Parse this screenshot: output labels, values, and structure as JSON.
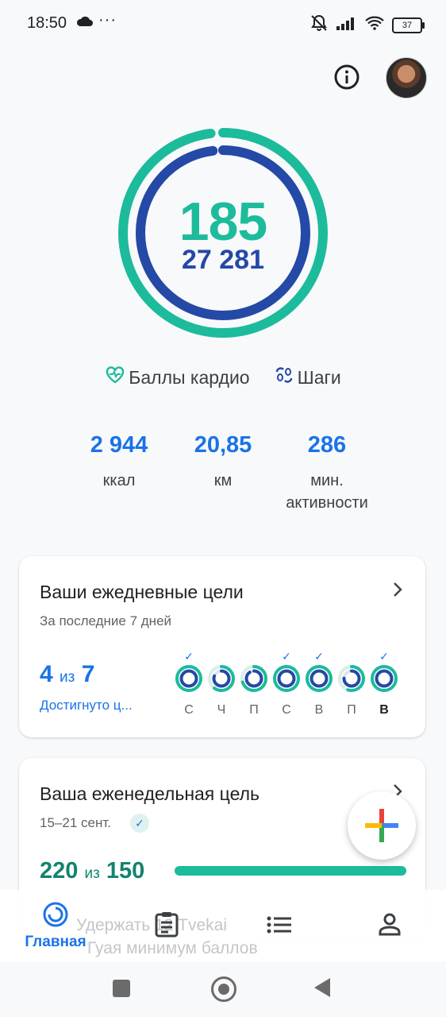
{
  "status_bar": {
    "time": "18:50",
    "dots": "···",
    "battery": "37"
  },
  "ring": {
    "main_value": "185",
    "sub_value": "27 281",
    "cardio_fill": 0.98,
    "steps_fill": 0.98,
    "colors": {
      "cardio": "#1cbb9c",
      "steps": "#2449a6"
    }
  },
  "legend": {
    "cardio_label": "Баллы кардио",
    "steps_label": "Шаги"
  },
  "stats": [
    {
      "value": "2 944",
      "label": "ккал"
    },
    {
      "value": "20,85",
      "label": "км"
    },
    {
      "value": "286",
      "label": "мин. активности"
    }
  ],
  "daily_goals": {
    "title": "Ваши ежедневные цели",
    "subtitle": "За последние 7 дней",
    "achieved": "4",
    "of_word": "из",
    "total": "7",
    "link": "Достигнуто ц...",
    "days": [
      {
        "label": "С",
        "done": true,
        "progress": 1.0,
        "bold": false
      },
      {
        "label": "Ч",
        "done": false,
        "progress": 0.6,
        "bold": false
      },
      {
        "label": "П",
        "done": false,
        "progress": 0.7,
        "bold": false
      },
      {
        "label": "С",
        "done": true,
        "progress": 1.0,
        "bold": false
      },
      {
        "label": "В",
        "done": true,
        "progress": 1.0,
        "bold": false
      },
      {
        "label": "П",
        "done": false,
        "progress": 0.55,
        "bold": false
      },
      {
        "label": "В",
        "done": true,
        "progress": 1.0,
        "bold": true
      }
    ]
  },
  "weekly_goal": {
    "title": "Ваша еженедельная цель",
    "dates": "15–21 сент.",
    "value": "220",
    "of_word": "из",
    "target": "150",
    "progress": 1.0
  },
  "behind_text": {
    "line1": "Удержать 12 Tvekai",
    "line2": "Гуая минимум баллов"
  },
  "bottom_nav": {
    "home_label": "Главная"
  }
}
